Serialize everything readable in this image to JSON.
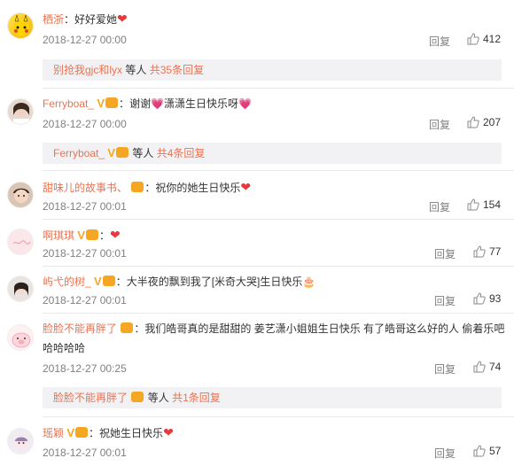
{
  "reply_label": "回复",
  "others_label": "等人",
  "comments": [
    {
      "name": "栖浙",
      "sep": "：",
      "text": "好好爱她",
      "time": "2018-12-27 00:00",
      "likes": "412"
    },
    {
      "name": "Ferryboat_",
      "sep": "：",
      "text_a": "谢谢",
      "text_b": "潇潇生日快乐呀",
      "time": "2018-12-27 00:00",
      "likes": "207"
    },
    {
      "name": "甜味儿的故事书、",
      "sep": "：",
      "text": "祝你的她生日快乐",
      "time": "2018-12-27 00:01",
      "likes": "154"
    },
    {
      "name": "啊琪琪",
      "sep": "：",
      "time": "2018-12-27 00:01",
      "likes": "77"
    },
    {
      "name": "屿弋的树_",
      "sep": "：",
      "text": "大半夜的飘到我了[米奇大哭]生日快乐",
      "time": "2018-12-27 00:01",
      "likes": "93"
    },
    {
      "name": "脸脸不能再胖了",
      "sep": "：",
      "text": "我们皓哥真的是甜甜的 姜艺潇小姐姐生日快乐 有了皓哥这么好的人 偷着乐吧",
      "text2": "哈哈哈哈",
      "time": "2018-12-27 00:25",
      "likes": "74"
    },
    {
      "name": "瑶颖",
      "sep": "：",
      "text": "祝她生日快乐",
      "time": "2018-12-27 00:01",
      "likes": "57"
    }
  ],
  "reply_bars": [
    {
      "names": "别抢我gjc和lyx",
      "count": "共35条回复"
    },
    {
      "names": "Ferryboat_",
      "count": "共4条回复"
    },
    {
      "names": "脸脸不能再胖了",
      "count": "共1条回复"
    }
  ]
}
